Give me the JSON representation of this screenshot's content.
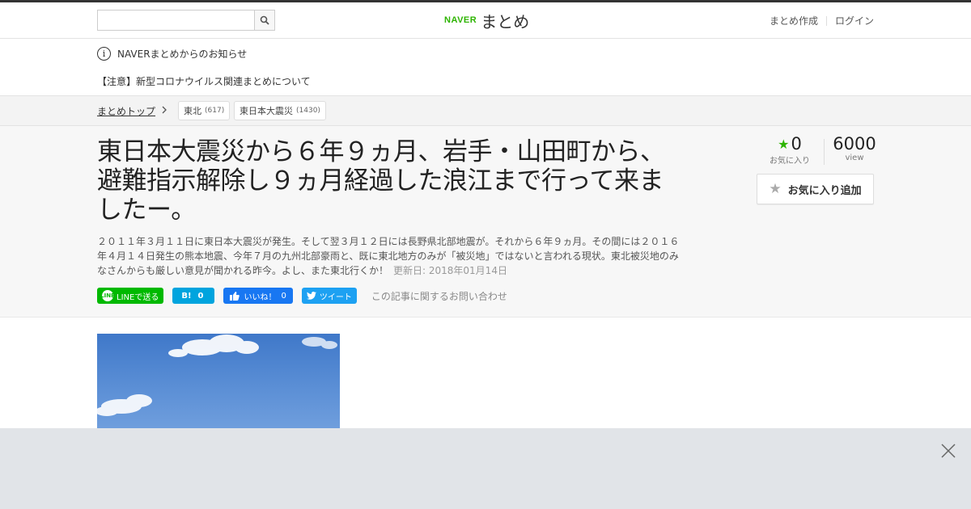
{
  "header": {
    "search_placeholder": "",
    "logo_brand": "NAVER",
    "logo_name": "まとめ",
    "links": [
      "まとめ作成",
      "ログイン"
    ]
  },
  "notice": {
    "title": "NAVERまとめからのお知らせ",
    "link": "【注意】新型コロナウイルス関連まとめについて"
  },
  "breadcrumb": {
    "home": "まとめトップ",
    "tags": [
      {
        "label": "東北",
        "count": "(617)"
      },
      {
        "label": "東日本大震災",
        "count": "(1430)"
      }
    ]
  },
  "article": {
    "title": "東日本大震災から６年９ヵ月、岩手・山田町から、避難指示解除し９ヵ月経過した浪江まで行って来ましたー。",
    "description": "２０１１年３月１１日に東日本大震災が発生。そして翌３月１２日には長野県北部地震が。それから６年９ヵ月。その間には２０１６年４月１４日発生の熊本地震、今年７月の九州北部豪雨と、既に東北地方のみが「被災地」ではないと言われる現状。東北被災地のみなさんからも厳しい意見が聞かれる昨今。よし、また東北行くか！",
    "updated": "更新日: 2018年01月14日"
  },
  "share": {
    "line": "LINEで送る",
    "line_icon_text": "LINE",
    "hatena_icon": "B!",
    "hatena_count": "0",
    "fb_label": "いいね！",
    "fb_count": "0",
    "tweet": "ツイート",
    "contact": "この記事に関するお問い合わせ"
  },
  "stats": {
    "favorites": "0",
    "favorites_label": "お気に入り",
    "views": "6000",
    "views_label": "view",
    "fav_button": "お気に入り追加"
  },
  "colors": {
    "brand": "#2db400",
    "line": "#00b900",
    "hatena": "#00a4de",
    "facebook": "#1877f2",
    "twitter": "#1da1f2"
  }
}
